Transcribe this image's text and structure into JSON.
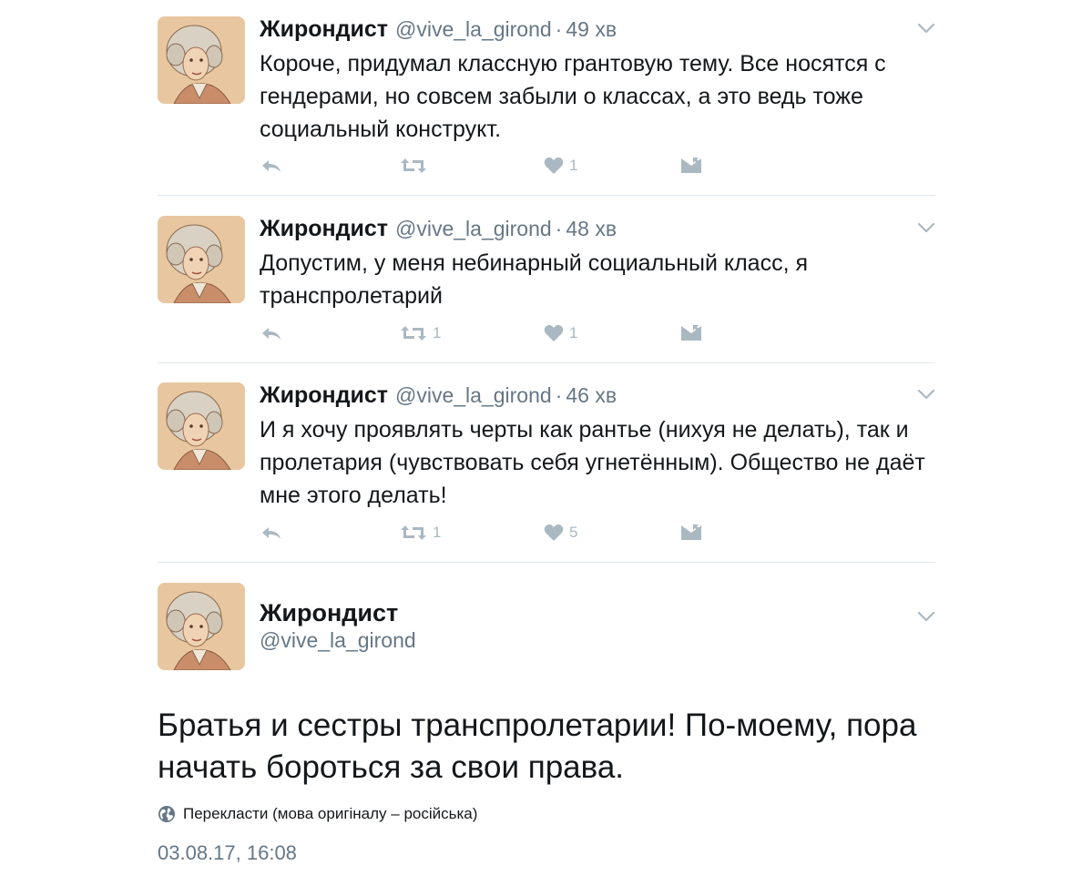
{
  "colors": {
    "text": "#14171a",
    "secondary": "#657786",
    "icon": "#aab8c2",
    "divider": "#e1e8ed"
  },
  "tweets": [
    {
      "name": "Жирондист",
      "handle": "@vive_la_girond",
      "separator": "·",
      "time": "49 хв",
      "text": "Короче, придумал классную грантовую тему. Все носятся с гендерами, но совсем забыли о классах, а это ведь тоже социальный конструкт.",
      "retweets": "",
      "likes": "1"
    },
    {
      "name": "Жирондист",
      "handle": "@vive_la_girond",
      "separator": "·",
      "time": "48 хв",
      "text": "Допустим, у меня небинарный социальный класс, я транспролетарий",
      "retweets": "1",
      "likes": "1"
    },
    {
      "name": "Жирондист",
      "handle": "@vive_la_girond",
      "separator": "·",
      "time": "46 хв",
      "text": "И я хочу проявлять черты как рантье (нихуя не делать), так и пролетария (чувствовать себя угнетённым). Общество не даёт мне этого делать!",
      "retweets": "1",
      "likes": "5"
    }
  ],
  "focused": {
    "name": "Жирондист",
    "handle": "@vive_la_girond",
    "text": "Братья и сестры транспролетарии! По-моему, пора начать бороться за свои права.",
    "translate": "Перекласти (мова оригіналу – російська)",
    "date": "03.08.17, 16:08"
  },
  "icons": {
    "reply": "reply-icon",
    "retweet": "retweet-icon",
    "like": "heart-icon",
    "dm": "envelope-icon",
    "menu": "chevron-down-icon",
    "globe": "globe-icon"
  }
}
